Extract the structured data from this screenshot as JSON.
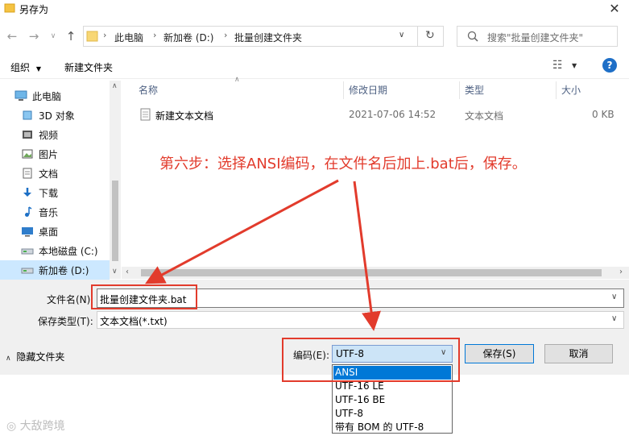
{
  "window": {
    "title": "另存为"
  },
  "nav": {
    "path": [
      "此电脑",
      "新加卷 (D:)",
      "批量创建文件夹"
    ],
    "search_placeholder": "搜索\"批量创建文件夹\""
  },
  "toolbar": {
    "organize": "组织",
    "new_folder": "新建文件夹"
  },
  "sidebar": {
    "items": [
      {
        "label": "此电脑",
        "icon": "computer-icon"
      },
      {
        "label": "3D 对象",
        "icon": "3d-objects-icon"
      },
      {
        "label": "视频",
        "icon": "video-icon"
      },
      {
        "label": "图片",
        "icon": "pictures-icon"
      },
      {
        "label": "文档",
        "icon": "documents-icon"
      },
      {
        "label": "下载",
        "icon": "download-icon"
      },
      {
        "label": "音乐",
        "icon": "music-icon"
      },
      {
        "label": "桌面",
        "icon": "desktop-icon"
      },
      {
        "label": "本地磁盘 (C:)",
        "icon": "drive-icon"
      },
      {
        "label": "新加卷 (D:)",
        "icon": "drive-icon",
        "selected": true
      }
    ]
  },
  "filelist": {
    "columns": [
      "名称",
      "修改日期",
      "类型",
      "大小"
    ],
    "rows": [
      {
        "name": "新建文本文档",
        "date": "2021-07-06 14:52",
        "type": "文本文档",
        "size": "0 KB"
      }
    ]
  },
  "annotation": "第六步：选择ANSI编码，在文件名后加上.bat后，保存。",
  "form": {
    "filename_label": "文件名(N):",
    "filename_value": "批量创建文件夹.bat",
    "filetype_label": "保存类型(T):",
    "filetype_value": "文本文档(*.txt)",
    "hide_folders": "隐藏文件夹",
    "encoding_label": "编码(E):",
    "encoding_value": "UTF-8",
    "encoding_options": [
      "ANSI",
      "UTF-16 LE",
      "UTF-16 BE",
      "UTF-8",
      "带有 BOM 的 UTF-8"
    ],
    "save": "保存(S)",
    "cancel": "取消"
  },
  "watermark": "大敌跨境",
  "colors": {
    "accent": "#0078d7",
    "annotation_red": "#e23b2c",
    "selected_bg": "#cce4f7"
  }
}
